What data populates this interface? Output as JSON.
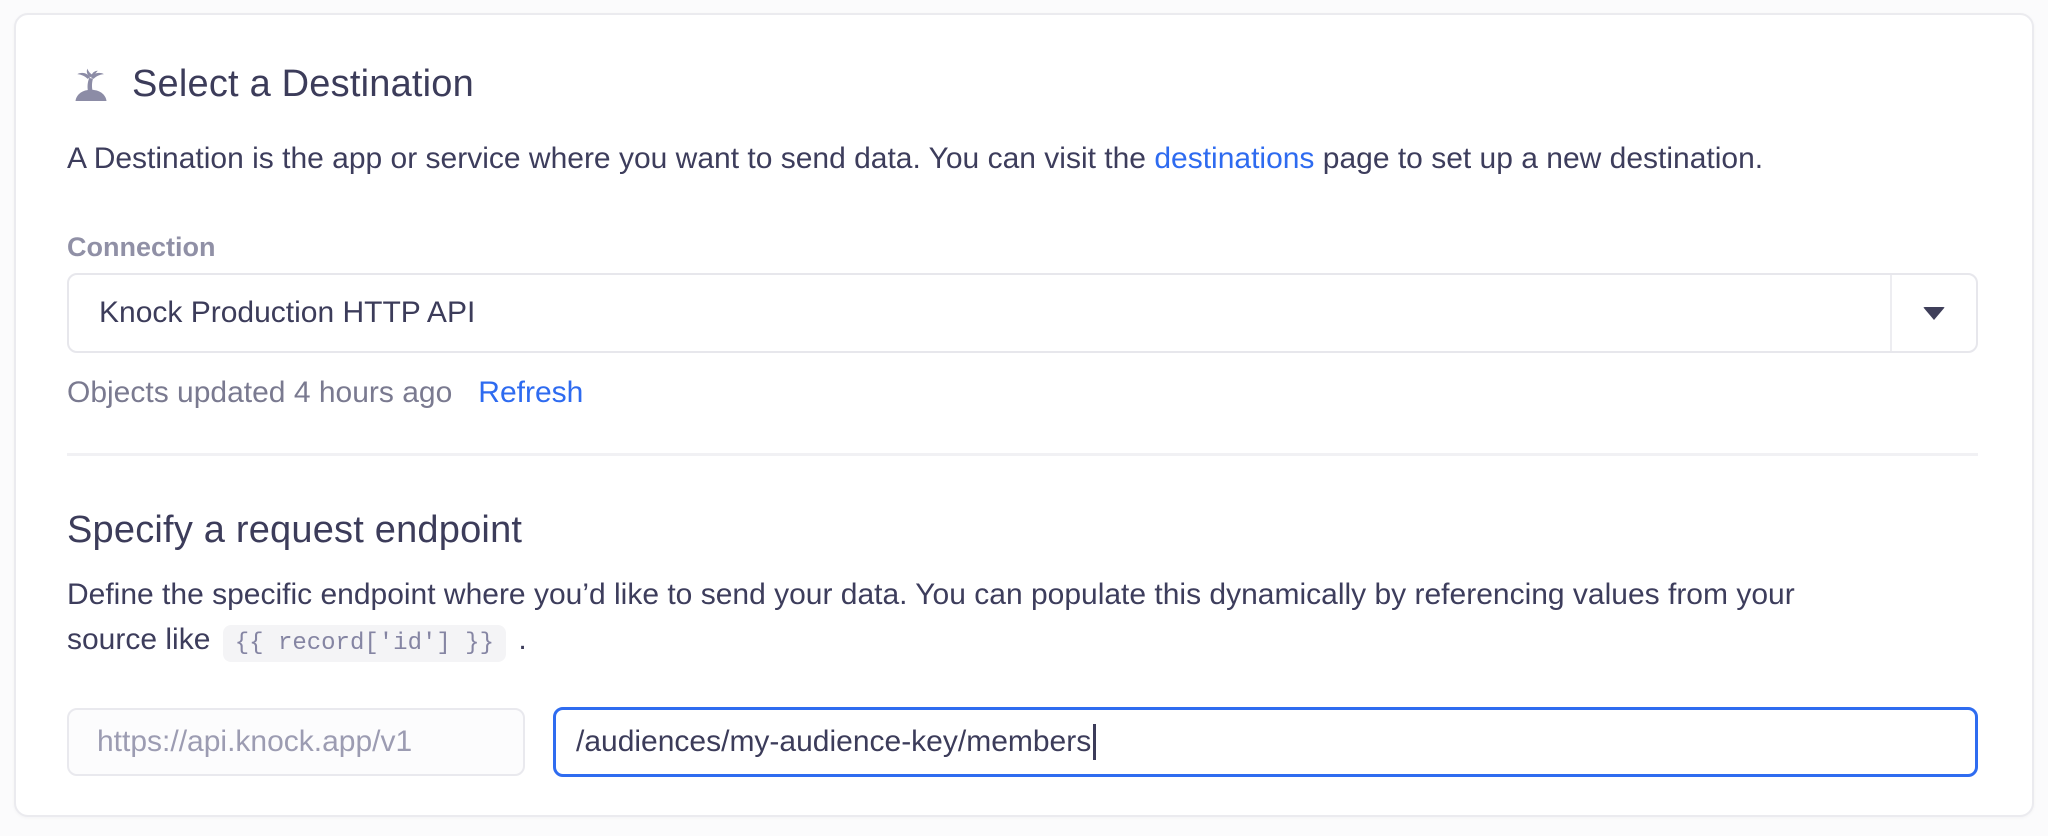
{
  "destination_section": {
    "icon": "palm-island-icon",
    "title": "Select a Destination",
    "description": {
      "before_link": "A Destination is the app or service where you want to send data. You can visit the ",
      "link_text": "destinations",
      "after_link": " page to set up a new destination."
    },
    "connection": {
      "label": "Connection",
      "selected_value": "Knock Production HTTP API",
      "status_text": "Objects updated 4 hours ago",
      "refresh_label": "Refresh"
    }
  },
  "endpoint_section": {
    "title": "Specify a request endpoint",
    "description": {
      "line1": "Define the specific endpoint where you’d like to send your data. You can populate this dynamically by referencing values from your",
      "line2_before_code": "source like ",
      "code": "{{ record['id'] }}",
      "line2_after_code": " ."
    },
    "base_url": "https://api.knock.app/v1",
    "endpoint_value": "/audiences/my-audience-key/members"
  },
  "colors": {
    "accent_link_blue": "#2e6bf0",
    "focus_border_blue": "#2f6cf0",
    "text_dark": "#3c3c5a",
    "text_gray": "#7a7a90",
    "label_gray": "#9090a6",
    "icon_gray_purple": "#8c8ca6"
  }
}
